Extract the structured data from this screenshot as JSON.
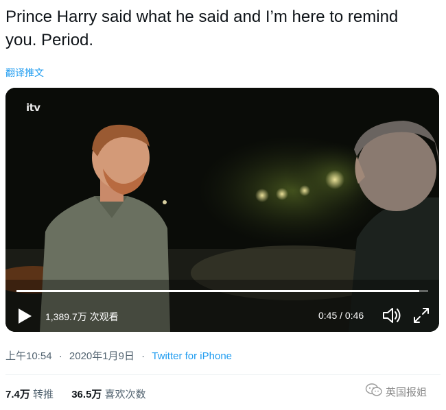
{
  "tweet": {
    "text": "Prince Harry said what he said and I’m here to remind you. Period.",
    "translate_label": "翻译推文"
  },
  "video": {
    "channel_logo": "itv",
    "views": "1,389.7万 次观看",
    "time": "0:45 / 0:46",
    "progress": 0.978,
    "icons": {
      "play": "play-icon",
      "volume": "volume-icon",
      "fullscreen": "fullscreen-icon"
    }
  },
  "meta": {
    "time": "上午10:54",
    "separator": "·",
    "date": "2020年1月9日",
    "source": "Twitter for iPhone"
  },
  "stats": {
    "retweets_count": "7.4万",
    "retweets_label": "转推",
    "likes_count": "36.5万",
    "likes_label": "喜欢次数"
  },
  "watermark": {
    "text": "英国报姐",
    "icon": "wechat-icon"
  },
  "colors": {
    "link": "#1d9bf0",
    "secondary": "#536471",
    "text": "#0f1419"
  }
}
